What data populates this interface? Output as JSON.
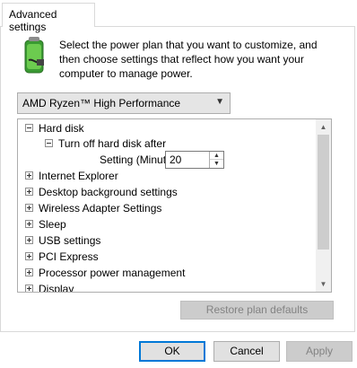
{
  "tab": {
    "label": "Advanced settings"
  },
  "description": {
    "line1": "Select the power plan that you want to customize, and",
    "line2": "then choose settings that reflect how you want your",
    "line3": "computer to manage power."
  },
  "plan_select": {
    "value": "AMD Ryzen™ High Performance"
  },
  "tree": {
    "hard_disk": "Hard disk",
    "turn_off_hard_disk": "Turn off hard disk after",
    "setting_label": "Setting (Minutes):",
    "setting_value": "20",
    "items": [
      "Internet Explorer",
      "Desktop background settings",
      "Wireless Adapter Settings",
      "Sleep",
      "USB settings",
      "PCI Express",
      "Processor power management",
      "Display"
    ]
  },
  "buttons": {
    "restore": "Restore plan defaults",
    "ok": "OK",
    "cancel": "Cancel",
    "apply": "Apply"
  },
  "icons": {
    "power_plan": "battery-plug-icon",
    "dropdown": "chevron-down-icon",
    "spin_up": "spin-up-icon",
    "spin_down": "spin-down-icon",
    "scroll_up": "scroll-up-icon",
    "scroll_down": "scroll-down-icon"
  },
  "colors": {
    "accent": "#0078d7",
    "disabled_text": "#838383"
  }
}
